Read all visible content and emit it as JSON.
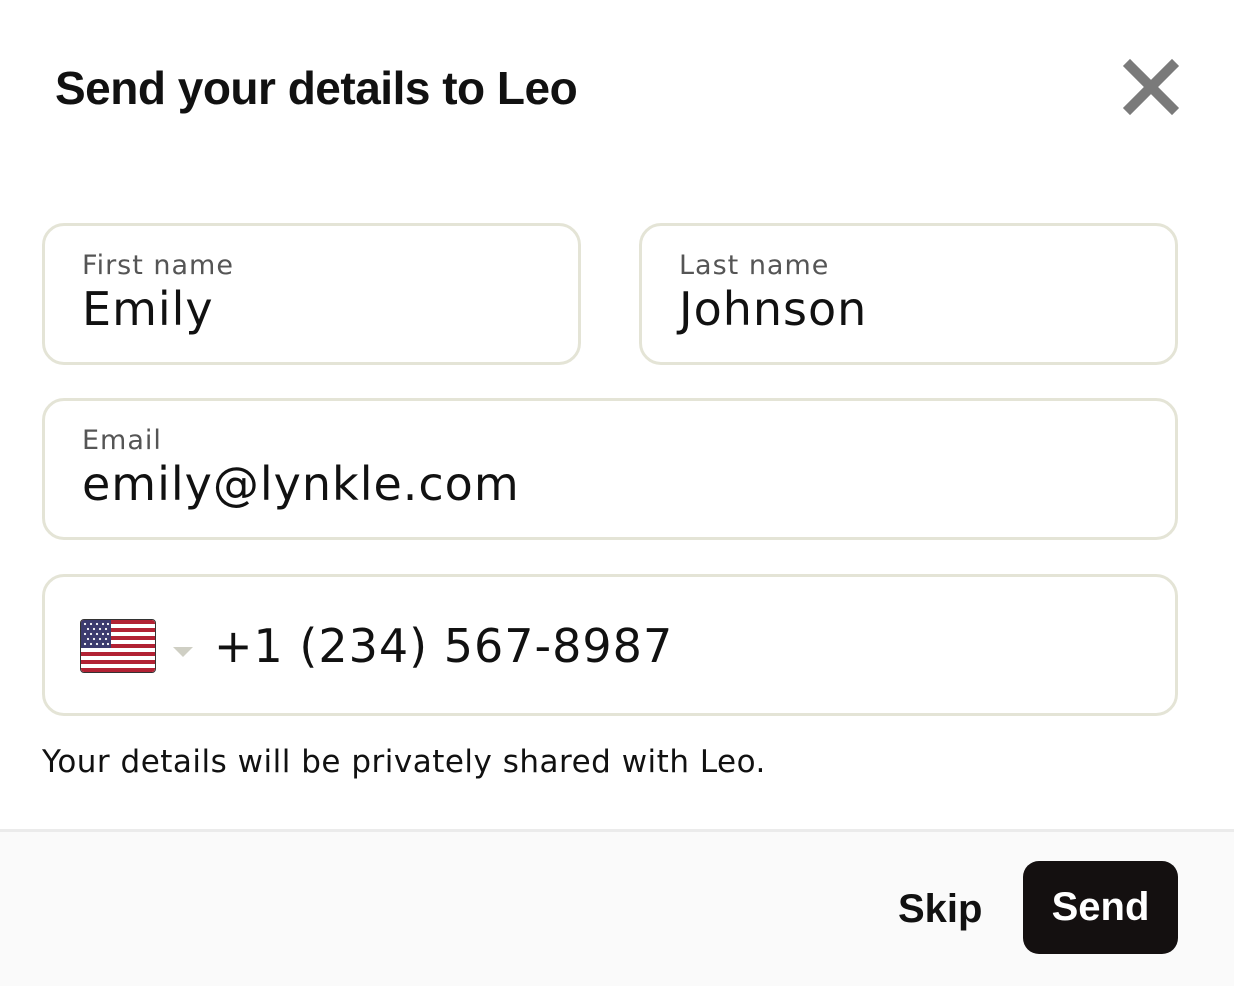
{
  "dialog": {
    "title": "Send your details to Leo",
    "close_icon": "close-icon"
  },
  "form": {
    "first_name": {
      "label": "First name",
      "value": "Emily"
    },
    "last_name": {
      "label": "Last name",
      "value": "Johnson"
    },
    "email": {
      "label": "Email",
      "value": "emily@lynkle.com"
    },
    "phone": {
      "country_flag_icon": "us-flag-icon",
      "dropdown_icon": "chevron-down-icon",
      "value": "+1 (234) 567-8987"
    },
    "helper_text": "Your details will be privately shared with Leo."
  },
  "footer": {
    "skip_label": "Skip",
    "send_label": "Send"
  },
  "colors": {
    "field_border": "#e4e4d6",
    "primary_button": "#141010",
    "footer_background": "#fafafa"
  }
}
